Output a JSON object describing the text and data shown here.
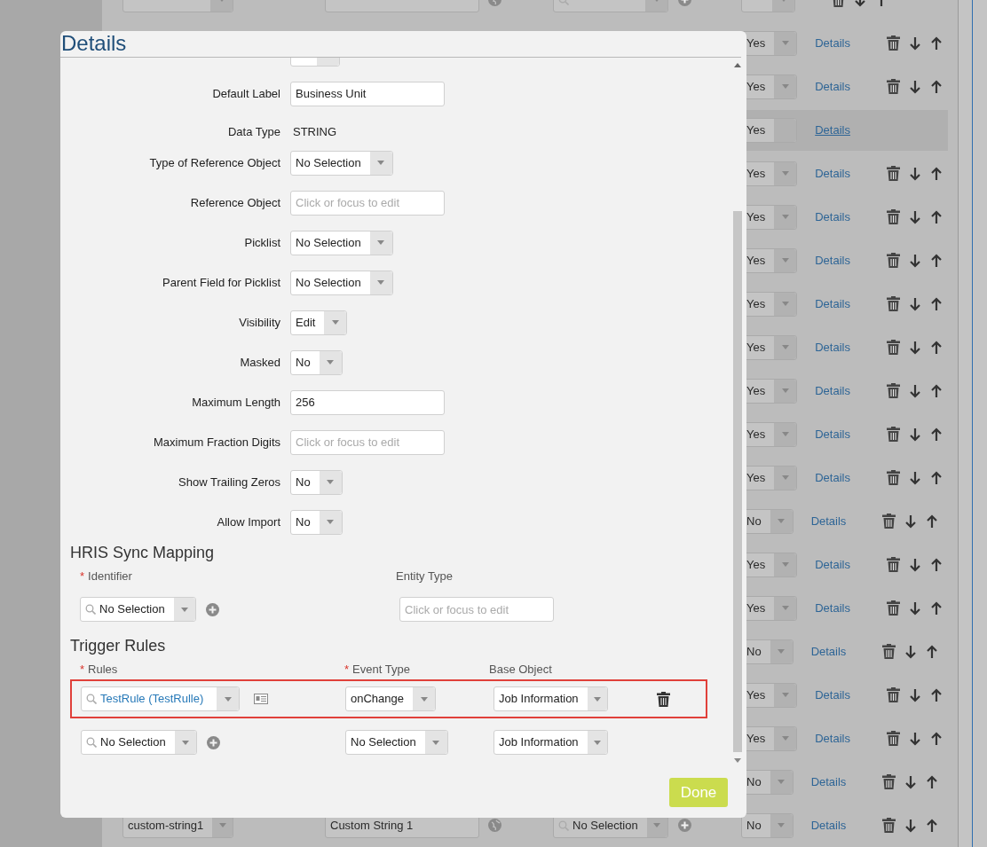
{
  "background_table": {
    "rows": [
      {
        "kind": "full",
        "highlighted": false
      },
      {
        "value": "Yes",
        "link": "Details",
        "highlighted": false
      },
      {
        "value": "Yes",
        "link": "Details",
        "highlighted": false
      },
      {
        "value": "Yes",
        "link": "Details",
        "highlighted": true
      },
      {
        "value": "Yes",
        "link": "Details",
        "highlighted": false
      },
      {
        "value": "Yes",
        "link": "Details",
        "highlighted": false
      },
      {
        "value": "Yes",
        "link": "Details",
        "highlighted": false
      },
      {
        "value": "Yes",
        "link": "Details",
        "highlighted": false
      },
      {
        "value": "Yes",
        "link": "Details",
        "highlighted": false
      },
      {
        "value": "Yes",
        "link": "Details",
        "highlighted": false
      },
      {
        "value": "Yes",
        "link": "Details",
        "highlighted": false
      },
      {
        "value": "Yes",
        "link": "Details",
        "highlighted": false
      },
      {
        "value": "No",
        "link": "Details",
        "highlighted": false
      },
      {
        "value": "Yes",
        "link": "Details",
        "highlighted": false
      },
      {
        "value": "Yes",
        "link": "Details",
        "highlighted": false
      },
      {
        "value": "No",
        "link": "Details",
        "highlighted": false
      },
      {
        "value": "Yes",
        "link": "Details",
        "highlighted": false
      },
      {
        "value": "Yes",
        "link": "Details",
        "highlighted": false
      },
      {
        "value": "No",
        "link": "Details",
        "highlighted": false
      },
      {
        "kind": "full",
        "name": "custom-string1",
        "label": "Custom String 1",
        "selection": "No Selection",
        "value": "No",
        "link": "Details",
        "highlighted": false
      }
    ]
  },
  "dialog": {
    "title": "Details",
    "fields": [
      {
        "kind": "select"
      },
      {
        "label": "Default Label",
        "kind": "input",
        "value": "Business Unit"
      },
      {
        "label": "Data Type",
        "kind": "text",
        "value": "STRING"
      },
      {
        "label": "Type of Reference Object",
        "kind": "select",
        "value": "No Selection"
      },
      {
        "label": "Reference Object",
        "kind": "input",
        "placeholder": "Click or focus to edit"
      },
      {
        "label": "Picklist",
        "kind": "select",
        "value": "No Selection"
      },
      {
        "label": "Parent Field for Picklist",
        "kind": "select",
        "value": "No Selection"
      },
      {
        "label": "Visibility",
        "kind": "select",
        "value": "Edit"
      },
      {
        "label": "Masked",
        "kind": "select",
        "value": "No"
      },
      {
        "label": "Maximum Length",
        "kind": "input",
        "value": "256"
      },
      {
        "label": "Maximum Fraction Digits",
        "kind": "input",
        "placeholder": "Click or focus to edit"
      },
      {
        "label": "Show Trailing Zeros",
        "kind": "select",
        "value": "No"
      },
      {
        "label": "Allow Import",
        "kind": "select",
        "value": "No"
      }
    ],
    "hris_sync_mapping": {
      "title": "HRIS Sync Mapping",
      "columns": [
        {
          "marker": "*",
          "label": "Identifier"
        },
        {
          "label": "Entity Type"
        }
      ],
      "identifier": {
        "value": "No Selection"
      },
      "entity_type": {
        "placeholder": "Click or focus to edit"
      }
    },
    "trigger_rules": {
      "title": "Trigger Rules",
      "columns": [
        {
          "marker": "*",
          "label": "Rules"
        },
        {
          "marker": "*",
          "label": "Event Type"
        },
        {
          "label": "Base Object"
        }
      ],
      "rows": [
        {
          "kind": "existing",
          "rule": "TestRule (TestRulle)",
          "event_type": "onChange",
          "base_object": "Job Information",
          "highlighted": true
        },
        {
          "kind": "new",
          "rule": "No Selection",
          "event_type": "No Selection",
          "base_object": "Job Information",
          "highlighted": false
        }
      ]
    },
    "done_button": "Done"
  }
}
